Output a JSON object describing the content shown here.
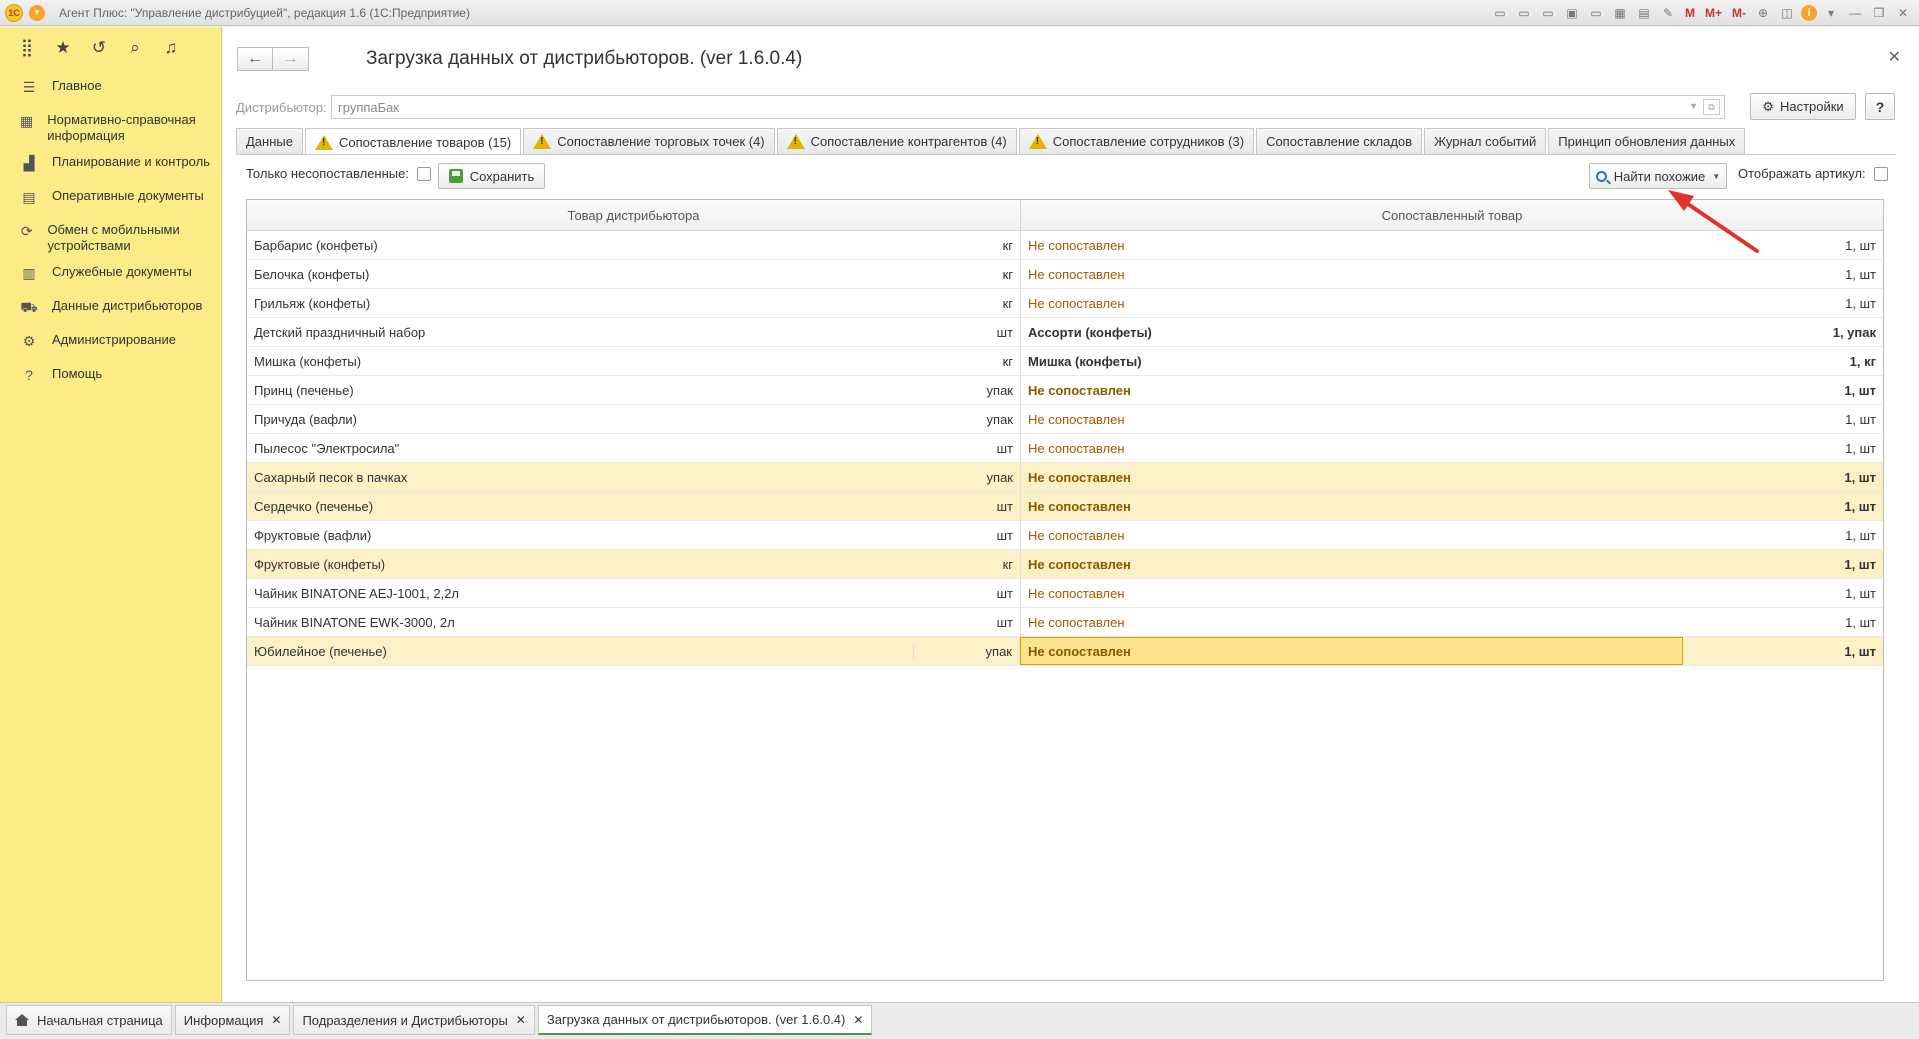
{
  "window": {
    "title": "Агент Плюс: \"Управление дистрибуцией\", редакция 1.6  (1С:Предприятие)",
    "logo_text": "1С",
    "memory_buttons": [
      "M",
      "M+",
      "M-"
    ]
  },
  "sidebar": {
    "items": [
      {
        "label": "Главное",
        "icon": "menu-lines-icon",
        "glyph": "☰"
      },
      {
        "label": "Нормативно-справочная информация",
        "icon": "grid-icon",
        "glyph": "▦"
      },
      {
        "label": "Планирование и контроль",
        "icon": "bar-chart-icon",
        "glyph": "▟"
      },
      {
        "label": "Оперативные документы",
        "icon": "document-icon",
        "glyph": "▤"
      },
      {
        "label": "Обмен с мобильными устройствами",
        "icon": "sync-icon",
        "glyph": "⟳"
      },
      {
        "label": "Служебные документы",
        "icon": "docs-icon",
        "glyph": "▥"
      },
      {
        "label": "Данные дистрибьюторов",
        "icon": "distributor-icon",
        "glyph": "⛟"
      },
      {
        "label": "Администрирование",
        "icon": "gear-icon",
        "glyph": "⚙"
      },
      {
        "label": "Помощь",
        "icon": "help-icon",
        "glyph": "?"
      }
    ]
  },
  "form": {
    "title": "Загрузка данных от дистрибьюторов. (ver 1.6.0.4)",
    "distributor_label": "Дистрибьютор:",
    "distributor_value": "группаБак",
    "settings_label": "Настройки",
    "help_label": "?"
  },
  "tabs": [
    {
      "label": "Данные",
      "warn": false,
      "active": false
    },
    {
      "label": "Сопоставление товаров (15)",
      "warn": true,
      "active": true
    },
    {
      "label": "Сопоставление торговых точек (4)",
      "warn": true,
      "active": false
    },
    {
      "label": "Сопоставление контрагентов (4)",
      "warn": true,
      "active": false
    },
    {
      "label": "Сопоставление сотрудников (3)",
      "warn": true,
      "active": false
    },
    {
      "label": "Сопоставление складов",
      "warn": false,
      "active": false
    },
    {
      "label": "Журнал событий",
      "warn": false,
      "active": false
    },
    {
      "label": "Принцип обновления данных",
      "warn": false,
      "active": false
    }
  ],
  "toolbar": {
    "only_unmatched_label": "Только несопоставленные:",
    "only_unmatched_checked": false,
    "save_label": "Сохранить",
    "find_similar_label": "Найти похожие",
    "show_article_label": "Отображать артикул:",
    "show_article_checked": false
  },
  "table": {
    "headers": [
      "Товар дистрибьютора",
      "Сопоставленный товар"
    ],
    "rows": [
      {
        "name": "Барбарис (конфеты)",
        "unit": "кг",
        "match": "Не сопоставлен",
        "qty": "1, шт",
        "matched": false,
        "bold": false,
        "highlight": false
      },
      {
        "name": "Белочка (конфеты)",
        "unit": "кг",
        "match": "Не сопоставлен",
        "qty": "1, шт",
        "matched": false,
        "bold": false,
        "highlight": false
      },
      {
        "name": "Грильяж (конфеты)",
        "unit": "кг",
        "match": "Не сопоставлен",
        "qty": "1, шт",
        "matched": false,
        "bold": false,
        "highlight": false
      },
      {
        "name": "Детский праздничный набор",
        "unit": "шт",
        "match": "Ассорти (конфеты)",
        "qty": "1, упак",
        "matched": true,
        "bold": true,
        "highlight": false
      },
      {
        "name": "Мишка (конфеты)",
        "unit": "кг",
        "match": "Мишка (конфеты)",
        "qty": "1, кг",
        "matched": true,
        "bold": true,
        "highlight": false
      },
      {
        "name": "Принц (печенье)",
        "unit": "упак",
        "match": "Не сопоставлен",
        "qty": "1, шт",
        "matched": false,
        "bold": true,
        "highlight": false
      },
      {
        "name": "Причуда (вафли)",
        "unit": "упак",
        "match": "Не сопоставлен",
        "qty": "1, шт",
        "matched": false,
        "bold": false,
        "highlight": false
      },
      {
        "name": "Пылесос \"Электросила\"",
        "unit": "шт",
        "match": "Не сопоставлен",
        "qty": "1, шт",
        "matched": false,
        "bold": false,
        "highlight": false
      },
      {
        "name": "Сахарный песок в пачках",
        "unit": "упак",
        "match": "Не сопоставлен",
        "qty": "1, шт",
        "matched": false,
        "bold": true,
        "highlight": true
      },
      {
        "name": "Сердечко (печенье)",
        "unit": "шт",
        "match": "Не сопоставлен",
        "qty": "1, шт",
        "matched": false,
        "bold": true,
        "highlight": true
      },
      {
        "name": "Фруктовые (вафли)",
        "unit": "шт",
        "match": "Не сопоставлен",
        "qty": "1, шт",
        "matched": false,
        "bold": false,
        "highlight": false
      },
      {
        "name": "Фруктовые (конфеты)",
        "unit": "кг",
        "match": "Не сопоставлен",
        "qty": "1, шт",
        "matched": false,
        "bold": true,
        "highlight": true
      },
      {
        "name": "Чайник BINATONE  AEJ-1001,  2,2л",
        "unit": "шт",
        "match": "Не сопоставлен",
        "qty": "1, шт",
        "matched": false,
        "bold": false,
        "highlight": false
      },
      {
        "name": "Чайник BINATONE  EWK-3000,  2л",
        "unit": "шт",
        "match": "Не сопоставлен",
        "qty": "1, шт",
        "matched": false,
        "bold": false,
        "highlight": false
      },
      {
        "name": "Юбилейное (печенье)",
        "unit": "упак",
        "match": "Не сопоставлен",
        "qty": "1, шт",
        "matched": false,
        "bold": true,
        "highlight": true,
        "selected": true
      }
    ]
  },
  "bottom_tabs": [
    {
      "label": "Начальная страница",
      "closable": false,
      "active": false
    },
    {
      "label": "Информация",
      "closable": true,
      "active": false
    },
    {
      "label": "Подразделения и Дистрибьюторы",
      "closable": true,
      "active": false
    },
    {
      "label": "Загрузка данных от дистрибьюторов. (ver 1.6.0.4)",
      "closable": true,
      "active": true
    }
  ],
  "colors": {
    "sidebar_bg": "#fbec88",
    "unmatched_text": "#a25a00",
    "highlight_row": "#fcf0c7",
    "selected_cell": "#fde38f",
    "annotation_arrow": "#e0322a"
  }
}
